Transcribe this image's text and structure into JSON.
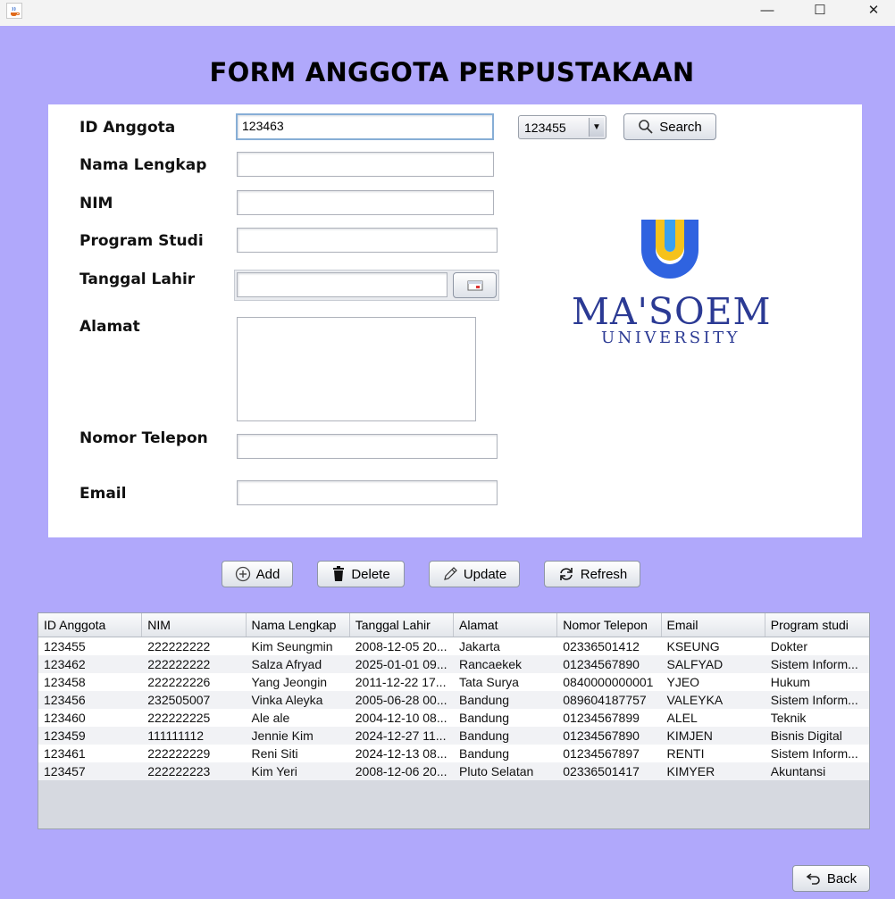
{
  "window": {
    "minimize_label": "—",
    "maximize_label": "☐",
    "close_label": "✕"
  },
  "form": {
    "title": "FORM ANGGOTA PERPUSTAKAAN",
    "labels": {
      "id": "ID Anggota",
      "nama": "Nama Lengkap",
      "nim": "NIM",
      "prodi": "Program Studi",
      "tanggal": "Tanggal Lahir",
      "alamat": "Alamat",
      "telepon": "Nomor Telepon",
      "email": "Email"
    },
    "values": {
      "id": "123463",
      "nama": "",
      "nim": "",
      "prodi": "",
      "tanggal": "",
      "alamat": "",
      "telepon": "",
      "email": ""
    },
    "id_select_value": "123455",
    "search_label": "Search"
  },
  "logo": {
    "title": "MA'SOEM",
    "subtitle": "UNIVERSITY",
    "colors": {
      "yellow": "#f6c21b",
      "blue": "#2f63e0",
      "navy": "#2b3a94"
    }
  },
  "actions": {
    "add": "Add",
    "delete": "Delete",
    "update": "Update",
    "refresh": "Refresh",
    "back": "Back"
  },
  "table": {
    "columns": [
      "ID Anggota",
      "NIM",
      "Nama Lengkap",
      "Tanggal Lahir",
      "Alamat",
      "Nomor Telepon",
      "Email",
      "Program studi"
    ],
    "rows": [
      [
        "123455",
        "222222222",
        "Kim Seungmin",
        "2008-12-05 20...",
        "Jakarta",
        "02336501412",
        "KSEUNG",
        "Dokter"
      ],
      [
        "123462",
        "222222222",
        "Salza Afryad",
        "2025-01-01 09...",
        "Rancaekek",
        "01234567890",
        "SALFYAD",
        "Sistem Inform..."
      ],
      [
        "123458",
        "222222226",
        "Yang Jeongin",
        "2011-12-22 17...",
        "Tata Surya",
        "0840000000001",
        "YJEO",
        "Hukum"
      ],
      [
        "123456",
        "232505007",
        "Vinka Aleyka",
        "2005-06-28 00...",
        "Bandung",
        "089604187757",
        "VALEYKA",
        "Sistem Inform..."
      ],
      [
        "123460",
        "222222225",
        "Ale ale",
        "2004-12-10 08...",
        "Bandung",
        "01234567899",
        "ALEL",
        "Teknik"
      ],
      [
        "123459",
        "111111112",
        "Jennie Kim",
        "2024-12-27 11...",
        "Bandung",
        "01234567890",
        "KIMJEN",
        "Bisnis Digital"
      ],
      [
        "123461",
        "222222229",
        "Reni Siti",
        "2024-12-13 08...",
        "Bandung",
        "01234567897",
        "RENTI",
        "Sistem Inform..."
      ],
      [
        "123457",
        "222222223",
        "Kim Yeri",
        "2008-12-06 20...",
        "Pluto Selatan",
        "02336501417",
        "KIMYER",
        "Akuntansi"
      ]
    ]
  }
}
